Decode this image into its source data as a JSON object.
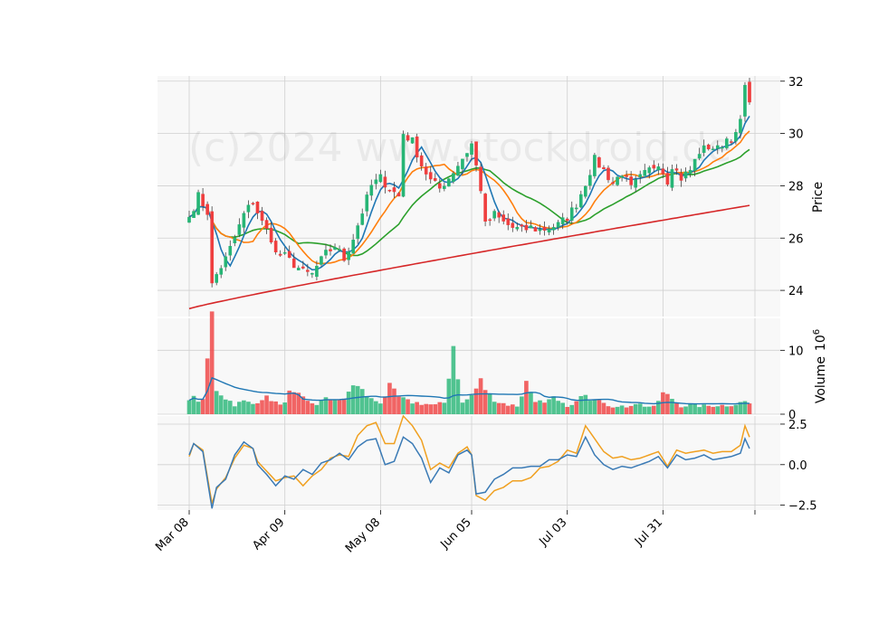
{
  "watermark": "(c)2024 www.stockdroid.de",
  "chart_data": {
    "type": "candlestick",
    "ylabel_price": "Price",
    "ylabel_volume": "Volume",
    "volume_multiplier": "10",
    "volume_multiplier_exp": "6",
    "x_tick_labels": [
      "Mar 08",
      "Apr 09",
      "May 08",
      "Jun 05",
      "Jul 03",
      "Jul 31"
    ],
    "x_tick_index": [
      0,
      21,
      42,
      62,
      83,
      104
    ],
    "price_ylim": [
      23,
      32.2
    ],
    "price_yticks": [
      24,
      26,
      28,
      30,
      32
    ],
    "volume_ylim": [
      0,
      15
    ],
    "volume_yticks": [
      0,
      10
    ],
    "osc_ylim": [
      -2.8,
      3.0
    ],
    "osc_yticks": [
      -2.5,
      0.0,
      2.5
    ],
    "colors": {
      "up": "#26b575",
      "down": "#ef3e3e",
      "ma_short": "#1f77b4",
      "ma_mid": "#ff7f0e",
      "ma_long": "#2ca02c",
      "ma_200": "#d62728",
      "osc_main": "#3a7ab5",
      "osc_signal": "#f0a020",
      "panel_bg": "#f8f8f8",
      "grid": "#d0d0d0"
    },
    "close_anchors": [
      [
        0,
        26.8
      ],
      [
        2,
        27.6
      ],
      [
        4,
        27.0
      ],
      [
        5,
        24.2
      ],
      [
        6,
        24.6
      ],
      [
        8,
        25.2
      ],
      [
        10,
        26.0
      ],
      [
        12,
        26.9
      ],
      [
        14,
        27.4
      ],
      [
        16,
        26.6
      ],
      [
        18,
        26.0
      ],
      [
        19,
        25.4
      ],
      [
        21,
        25.3
      ],
      [
        23,
        25.0
      ],
      [
        25,
        24.7
      ],
      [
        27,
        24.6
      ],
      [
        28,
        24.9
      ],
      [
        30,
        25.4
      ],
      [
        32,
        25.7
      ],
      [
        34,
        25.2
      ],
      [
        36,
        26.0
      ],
      [
        38,
        27.0
      ],
      [
        40,
        28.0
      ],
      [
        42,
        28.3
      ],
      [
        44,
        27.9
      ],
      [
        46,
        27.6
      ],
      [
        47,
        30.0
      ],
      [
        49,
        29.7
      ],
      [
        51,
        28.8
      ],
      [
        53,
        28.2
      ],
      [
        55,
        27.9
      ],
      [
        57,
        28.3
      ],
      [
        59,
        28.8
      ],
      [
        61,
        29.3
      ],
      [
        62,
        29.6
      ],
      [
        64,
        27.9
      ],
      [
        65,
        26.5
      ],
      [
        67,
        26.9
      ],
      [
        69,
        26.6
      ],
      [
        71,
        26.4
      ],
      [
        73,
        26.3
      ],
      [
        75,
        26.4
      ],
      [
        77,
        26.3
      ],
      [
        79,
        26.4
      ],
      [
        81,
        26.5
      ],
      [
        83,
        26.8
      ],
      [
        85,
        27.3
      ],
      [
        87,
        28.1
      ],
      [
        89,
        29.0
      ],
      [
        91,
        28.6
      ],
      [
        93,
        28.1
      ],
      [
        95,
        28.5
      ],
      [
        97,
        27.9
      ],
      [
        99,
        28.3
      ],
      [
        101,
        28.6
      ],
      [
        103,
        28.9
      ],
      [
        105,
        28.2
      ],
      [
        106,
        28.8
      ],
      [
        108,
        28.3
      ],
      [
        110,
        28.6
      ],
      [
        112,
        29.3
      ],
      [
        114,
        29.5
      ],
      [
        116,
        29.4
      ],
      [
        118,
        29.8
      ],
      [
        120,
        29.9
      ],
      [
        121,
        30.5
      ],
      [
        122,
        31.7
      ],
      [
        123,
        31.2
      ]
    ],
    "volume_anchors": [
      [
        0,
        2.7
      ],
      [
        3,
        2.0
      ],
      [
        5,
        15.0
      ],
      [
        6,
        4.0
      ],
      [
        8,
        2.6
      ],
      [
        10,
        1.5
      ],
      [
        12,
        2.0
      ],
      [
        14,
        1.6
      ],
      [
        16,
        2.6
      ],
      [
        18,
        2.4
      ],
      [
        20,
        1.3
      ],
      [
        22,
        3.2
      ],
      [
        24,
        2.8
      ],
      [
        26,
        1.9
      ],
      [
        28,
        1.6
      ],
      [
        30,
        2.3
      ],
      [
        32,
        2.5
      ],
      [
        34,
        2.1
      ],
      [
        36,
        4.8
      ],
      [
        38,
        3.6
      ],
      [
        40,
        2.3
      ],
      [
        42,
        1.9
      ],
      [
        44,
        4.1
      ],
      [
        46,
        2.6
      ],
      [
        48,
        2.0
      ],
      [
        50,
        1.8
      ],
      [
        52,
        1.6
      ],
      [
        54,
        1.4
      ],
      [
        56,
        1.8
      ],
      [
        58,
        10.9
      ],
      [
        60,
        1.7
      ],
      [
        62,
        2.9
      ],
      [
        64,
        5.1
      ],
      [
        66,
        2.9
      ],
      [
        68,
        1.9
      ],
      [
        70,
        1.5
      ],
      [
        72,
        1.3
      ],
      [
        74,
        4.9
      ],
      [
        76,
        2.3
      ],
      [
        78,
        1.6
      ],
      [
        80,
        2.4
      ],
      [
        82,
        1.5
      ],
      [
        84,
        1.3
      ],
      [
        86,
        2.6
      ],
      [
        88,
        2.6
      ],
      [
        90,
        2.7
      ],
      [
        92,
        1.5
      ],
      [
        94,
        1.1
      ],
      [
        96,
        1.2
      ],
      [
        98,
        1.8
      ],
      [
        100,
        1.3
      ],
      [
        102,
        1.1
      ],
      [
        104,
        3.2
      ],
      [
        106,
        2.5
      ],
      [
        108,
        1.3
      ],
      [
        110,
        1.4
      ],
      [
        112,
        1.3
      ],
      [
        114,
        1.3
      ],
      [
        116,
        1.4
      ],
      [
        118,
        1.4
      ],
      [
        120,
        1.6
      ],
      [
        122,
        2.0
      ],
      [
        123,
        1.7
      ]
    ],
    "osc_main_anchors": [
      [
        0,
        0.6
      ],
      [
        1,
        1.3
      ],
      [
        3,
        0.8
      ],
      [
        5,
        -2.7
      ],
      [
        6,
        -1.4
      ],
      [
        8,
        -0.9
      ],
      [
        10,
        0.6
      ],
      [
        12,
        1.4
      ],
      [
        14,
        1.0
      ],
      [
        15,
        0.0
      ],
      [
        17,
        -0.6
      ],
      [
        19,
        -1.3
      ],
      [
        21,
        -0.7
      ],
      [
        23,
        -0.9
      ],
      [
        25,
        -0.3
      ],
      [
        27,
        -0.6
      ],
      [
        29,
        0.1
      ],
      [
        31,
        0.3
      ],
      [
        33,
        0.7
      ],
      [
        35,
        0.3
      ],
      [
        37,
        1.1
      ],
      [
        39,
        1.5
      ],
      [
        41,
        1.6
      ],
      [
        43,
        0.0
      ],
      [
        45,
        0.2
      ],
      [
        47,
        1.7
      ],
      [
        49,
        1.3
      ],
      [
        51,
        0.4
      ],
      [
        53,
        -1.1
      ],
      [
        55,
        -0.2
      ],
      [
        57,
        -0.5
      ],
      [
        59,
        0.6
      ],
      [
        61,
        0.9
      ],
      [
        62,
        0.6
      ],
      [
        63,
        -1.8
      ],
      [
        65,
        -1.7
      ],
      [
        67,
        -0.9
      ],
      [
        69,
        -0.6
      ],
      [
        71,
        -0.2
      ],
      [
        73,
        -0.2
      ],
      [
        75,
        -0.1
      ],
      [
        77,
        -0.1
      ],
      [
        79,
        0.3
      ],
      [
        81,
        0.3
      ],
      [
        83,
        0.6
      ],
      [
        85,
        0.5
      ],
      [
        87,
        1.7
      ],
      [
        89,
        0.6
      ],
      [
        91,
        0.0
      ],
      [
        93,
        -0.3
      ],
      [
        95,
        -0.1
      ],
      [
        97,
        -0.2
      ],
      [
        99,
        0.0
      ],
      [
        101,
        0.2
      ],
      [
        103,
        0.5
      ],
      [
        105,
        -0.2
      ],
      [
        107,
        0.6
      ],
      [
        109,
        0.3
      ],
      [
        111,
        0.4
      ],
      [
        113,
        0.6
      ],
      [
        115,
        0.3
      ],
      [
        117,
        0.4
      ],
      [
        119,
        0.5
      ],
      [
        121,
        0.7
      ],
      [
        122,
        1.6
      ],
      [
        123,
        1.0
      ]
    ],
    "osc_signal_anchors": [
      [
        0,
        0.5
      ],
      [
        1,
        1.3
      ],
      [
        3,
        0.9
      ],
      [
        5,
        -2.4
      ],
      [
        6,
        -1.5
      ],
      [
        8,
        -0.8
      ],
      [
        10,
        0.4
      ],
      [
        12,
        1.2
      ],
      [
        14,
        1.0
      ],
      [
        15,
        0.2
      ],
      [
        17,
        -0.4
      ],
      [
        19,
        -1.0
      ],
      [
        21,
        -0.8
      ],
      [
        23,
        -0.7
      ],
      [
        25,
        -1.3
      ],
      [
        27,
        -0.7
      ],
      [
        29,
        -0.3
      ],
      [
        31,
        0.4
      ],
      [
        33,
        0.6
      ],
      [
        35,
        0.5
      ],
      [
        37,
        1.8
      ],
      [
        39,
        2.4
      ],
      [
        41,
        2.6
      ],
      [
        43,
        1.3
      ],
      [
        45,
        1.3
      ],
      [
        47,
        3.0
      ],
      [
        49,
        2.4
      ],
      [
        51,
        1.5
      ],
      [
        53,
        -0.3
      ],
      [
        55,
        0.1
      ],
      [
        57,
        -0.2
      ],
      [
        59,
        0.7
      ],
      [
        61,
        1.1
      ],
      [
        62,
        0.6
      ],
      [
        63,
        -1.9
      ],
      [
        65,
        -2.2
      ],
      [
        67,
        -1.6
      ],
      [
        69,
        -1.4
      ],
      [
        71,
        -1.0
      ],
      [
        73,
        -1.0
      ],
      [
        75,
        -0.8
      ],
      [
        77,
        -0.2
      ],
      [
        79,
        -0.1
      ],
      [
        81,
        0.2
      ],
      [
        83,
        0.9
      ],
      [
        85,
        0.7
      ],
      [
        87,
        2.4
      ],
      [
        89,
        1.6
      ],
      [
        91,
        0.8
      ],
      [
        93,
        0.4
      ],
      [
        95,
        0.5
      ],
      [
        97,
        0.3
      ],
      [
        99,
        0.4
      ],
      [
        101,
        0.6
      ],
      [
        103,
        0.8
      ],
      [
        105,
        -0.1
      ],
      [
        107,
        0.9
      ],
      [
        109,
        0.7
      ],
      [
        111,
        0.8
      ],
      [
        113,
        0.9
      ],
      [
        115,
        0.7
      ],
      [
        117,
        0.8
      ],
      [
        119,
        0.8
      ],
      [
        121,
        1.2
      ],
      [
        122,
        2.4
      ],
      [
        123,
        1.7
      ]
    ],
    "ma200_start": 23.3,
    "ma200_end": 27.25,
    "n": 124
  }
}
